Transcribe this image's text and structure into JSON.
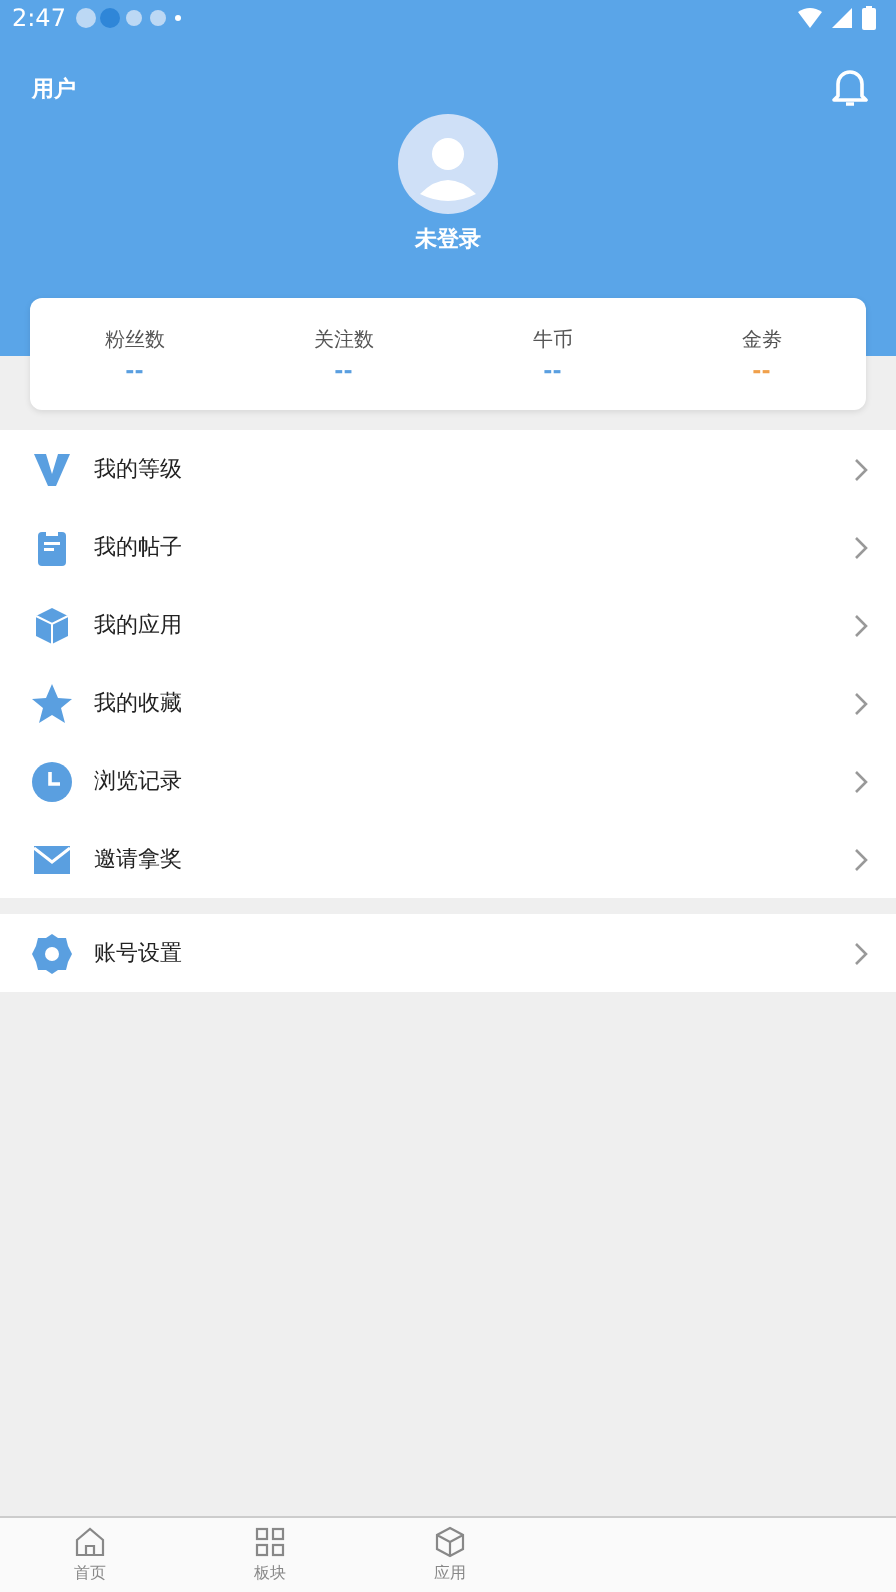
{
  "status_bar": {
    "time": "2:47"
  },
  "header": {
    "title": "用户",
    "user_name": "未登录"
  },
  "stats": [
    {
      "label": "粉丝数",
      "value": "--",
      "color": "#5a9fe0"
    },
    {
      "label": "关注数",
      "value": "--",
      "color": "#5a9fe0"
    },
    {
      "label": "牛币",
      "value": "--",
      "color": "#5a9fe0"
    },
    {
      "label": "金劵",
      "value": "--",
      "color": "#f0a04b"
    }
  ],
  "menu": [
    {
      "kind": "level",
      "label": "我的等级"
    },
    {
      "kind": "posts",
      "label": "我的帖子"
    },
    {
      "kind": "apps",
      "label": "我的应用"
    },
    {
      "kind": "favorites",
      "label": "我的收藏"
    },
    {
      "kind": "history",
      "label": "浏览记录"
    },
    {
      "kind": "invite",
      "label": "邀请拿奖"
    }
  ],
  "settings_menu": [
    {
      "kind": "settings",
      "label": "账号设置"
    }
  ],
  "tab_bar": [
    {
      "kind": "home",
      "label": "首页",
      "selected": false
    },
    {
      "kind": "boards",
      "label": "板块",
      "selected": false
    },
    {
      "kind": "apps",
      "label": "应用",
      "selected": false
    }
  ]
}
